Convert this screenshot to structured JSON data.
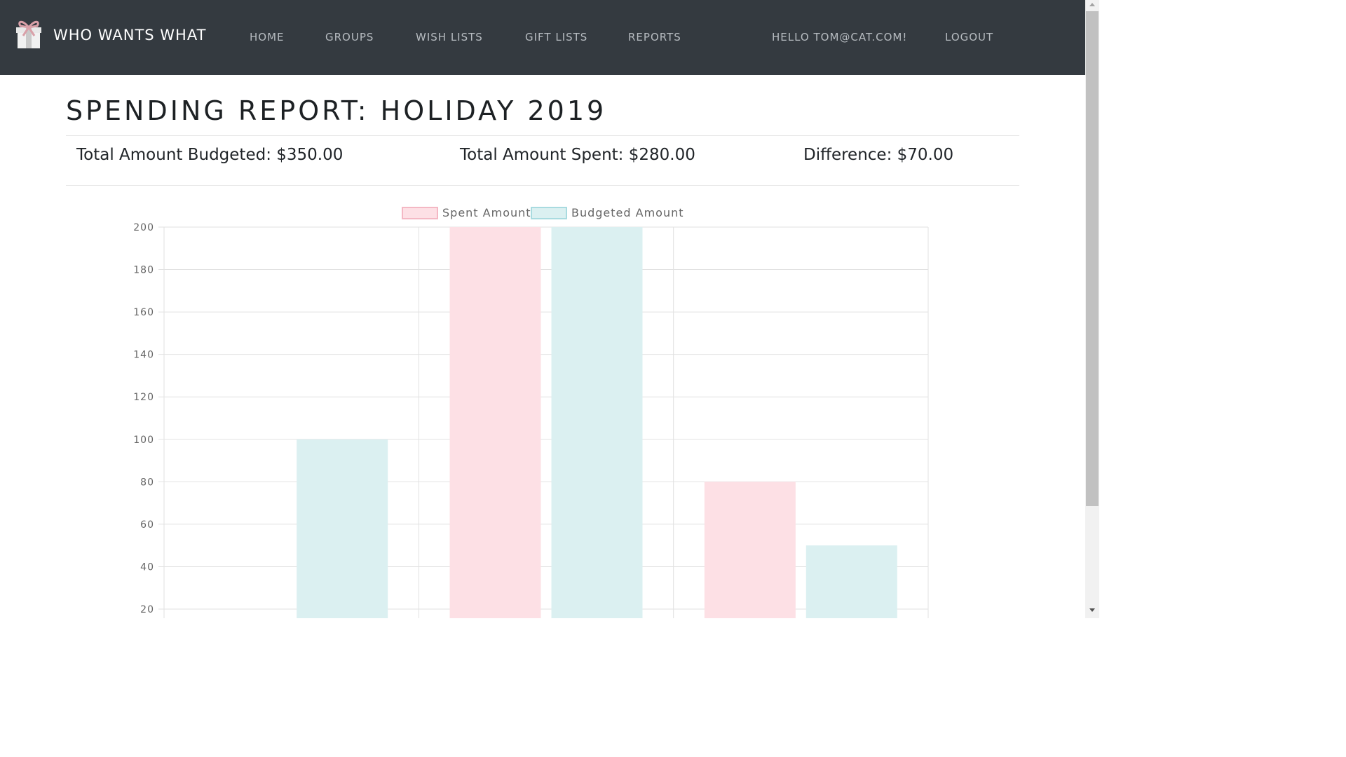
{
  "navbar": {
    "brand": "WHO WANTS WHAT",
    "links": [
      "HOME",
      "GROUPS",
      "WISH LISTS",
      "GIFT LISTS",
      "REPORTS"
    ],
    "greeting": "HELLO TOM@CAT.COM!",
    "logout": "LOGOUT"
  },
  "report": {
    "title": "SPENDING REPORT: HOLIDAY 2019",
    "total_budgeted": "Total Amount Budgeted: $350.00",
    "total_spent": "Total Amount Spent: $280.00",
    "difference": "Difference: $70.00"
  },
  "colors": {
    "navbar_bg": "#343a40",
    "spent": "#fde0e5",
    "budgeted": "#dbf0f1"
  },
  "chart_data": {
    "type": "bar",
    "categories": [
      "",
      "",
      ""
    ],
    "series": [
      {
        "name": "Spent Amount",
        "values": [
          0,
          200,
          80
        ]
      },
      {
        "name": "Budgeted Amount",
        "values": [
          100,
          200,
          50
        ]
      }
    ],
    "y_ticks": [
      20,
      40,
      60,
      80,
      100,
      120,
      140,
      160,
      180,
      200
    ],
    "ylim": [
      0,
      200
    ],
    "legend": "top-center",
    "grid": true
  }
}
